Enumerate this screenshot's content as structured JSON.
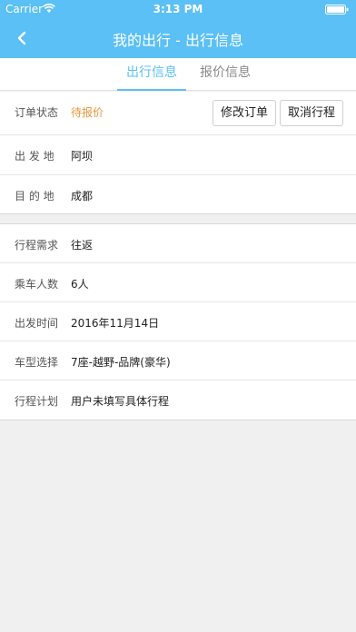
{
  "status_bar": {
    "carrier": "Carrier",
    "time": "3:13 PM"
  },
  "nav": {
    "title": "我的出行 - 出行信息"
  },
  "tabs": [
    {
      "label": "出行信息",
      "active": true
    },
    {
      "label": "报价信息",
      "active": false
    }
  ],
  "order": {
    "status_label": "订单状态",
    "status_value": "待报价",
    "edit_button": "修改订单",
    "cancel_button": "取消行程",
    "departure_label": "出 发 地",
    "departure_value": "阿坝",
    "destination_label": "目 的 地",
    "destination_value": "成都"
  },
  "trip": {
    "need_label": "行程需求",
    "need_value": "往返",
    "passengers_label": "乘车人数",
    "passengers_value": "6人",
    "time_label": "出发时间",
    "time_value": "2016年11月14日",
    "car_label": "车型选择",
    "car_value": "7座-越野-品牌(豪华)",
    "plan_label": "行程计划",
    "plan_value": "用户未填写具体行程"
  },
  "colors": {
    "accent": "#5ac0f5",
    "status": "#e8953a"
  },
  "icons": [
    "wifi-icon",
    "battery-icon",
    "back-chevron-icon"
  ]
}
